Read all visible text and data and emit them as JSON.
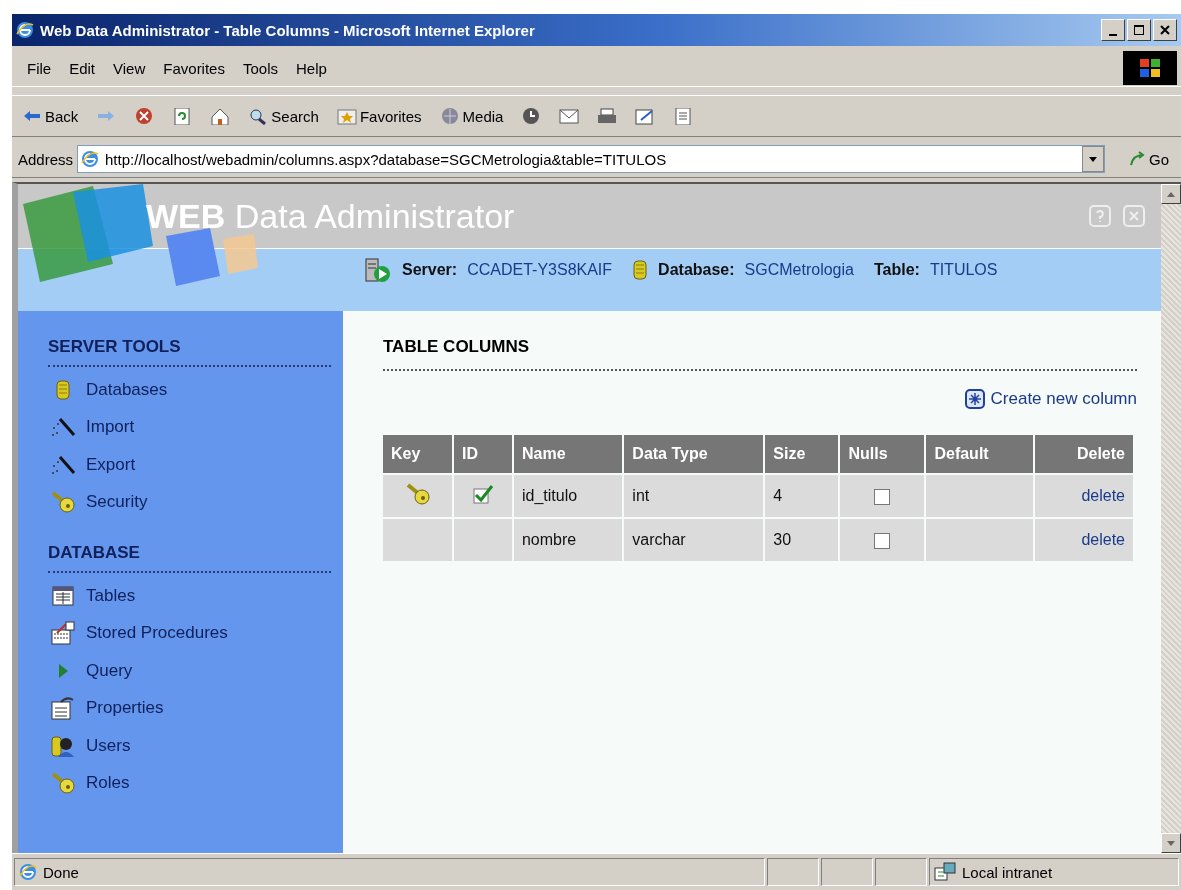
{
  "window": {
    "title": "Web Data Administrator - Table Columns - Microsoft Internet Explorer"
  },
  "menu": [
    "File",
    "Edit",
    "View",
    "Favorites",
    "Tools",
    "Help"
  ],
  "toolbar": [
    {
      "kind": "back",
      "label": "Back"
    },
    {
      "kind": "forward"
    },
    {
      "kind": "stop"
    },
    {
      "kind": "refresh"
    },
    {
      "kind": "home"
    },
    {
      "kind": "search",
      "label": "Search"
    },
    {
      "kind": "favorites",
      "label": "Favorites"
    },
    {
      "kind": "media",
      "label": "Media"
    },
    {
      "kind": "history"
    },
    {
      "kind": "mail"
    },
    {
      "kind": "print"
    },
    {
      "kind": "edit"
    },
    {
      "kind": "discuss"
    }
  ],
  "address": {
    "label": "Address",
    "url": "http://localhost/webadmin/columns.aspx?database=SGCMetrologia&table=TITULOS",
    "go": "Go"
  },
  "page": {
    "brand": "WEB",
    "title": "Data Administrator",
    "info": [
      {
        "label": "Server:",
        "value": "CCADET-Y3S8KAIF",
        "kind": "server"
      },
      {
        "label": "Database:",
        "value": "SGCMetrologia",
        "kind": "database"
      },
      {
        "label": "Table:",
        "value": "TITULOS",
        "kind": "table"
      }
    ],
    "sidebar": [
      {
        "title": "SERVER TOOLS",
        "items": [
          {
            "label": "Databases",
            "kind": "database"
          },
          {
            "label": "Import",
            "kind": "wand"
          },
          {
            "label": "Export",
            "kind": "wand"
          },
          {
            "label": "Security",
            "kind": "key"
          }
        ]
      },
      {
        "title": "DATABASE",
        "items": [
          {
            "label": "Tables",
            "kind": "table"
          },
          {
            "label": "Stored Procedures",
            "kind": "procedure"
          },
          {
            "label": "Query",
            "kind": "play"
          },
          {
            "label": "Properties",
            "kind": "properties"
          },
          {
            "label": "Users",
            "kind": "users"
          },
          {
            "label": "Roles",
            "kind": "key"
          }
        ]
      }
    ],
    "heading": "TABLE COLUMNS",
    "create_link": "Create new column",
    "table": {
      "columns": [
        "Key",
        "ID",
        "Name",
        "Data Type",
        "Size",
        "Nulls",
        "Default",
        "Delete"
      ],
      "rows": [
        {
          "key": true,
          "identity": true,
          "name": "id_titulo",
          "type": "int",
          "size": "4",
          "nulls": false,
          "delete": "delete"
        },
        {
          "key": false,
          "identity": false,
          "name": "nombre",
          "type": "varchar",
          "size": "30",
          "nulls": false,
          "delete": "delete"
        }
      ]
    }
  },
  "status": {
    "text": "Done",
    "zone": "Local intranet"
  }
}
